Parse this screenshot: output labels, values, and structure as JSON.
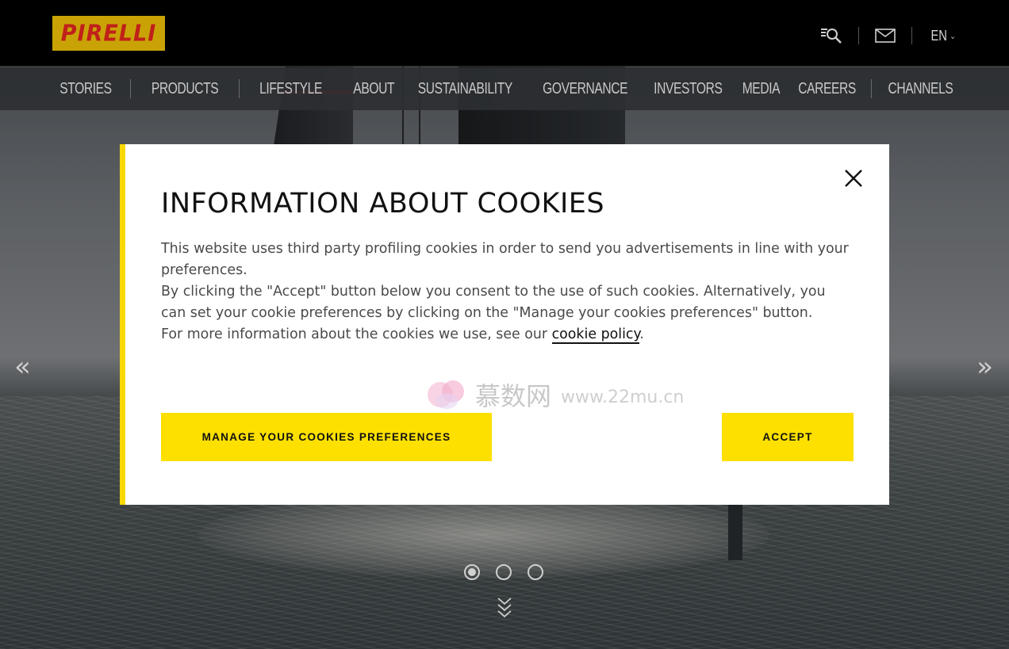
{
  "brand": {
    "logo_text": "PIRELLI",
    "logo_bg": "#c9a306",
    "logo_fg": "#c0201a",
    "accent": "#fde000"
  },
  "header": {
    "icons": [
      "search-icon",
      "mail-icon"
    ],
    "language": "EN"
  },
  "nav": {
    "left": [
      "STORIES",
      "PRODUCTS",
      "LIFESTYLE"
    ],
    "right": [
      "ABOUT",
      "SUSTAINABILITY",
      "GOVERNANCE",
      "INVESTORS",
      "MEDIA",
      "CAREERS",
      "CHANNELS"
    ]
  },
  "slider": {
    "prev_arrow": "«",
    "next_arrow": "»",
    "dots_count": 3,
    "active_dot": 1
  },
  "modal": {
    "title": "INFORMATION ABOUT COOKIES",
    "para1": "This website uses third party profiling cookies in order to send you advertisements in line with your preferences.",
    "para2": "By clicking the \"Accept\" button below you consent to the use of such cookies. Alternatively, you can set your cookie preferences by clicking on the \"Manage your cookies preferences\" button.",
    "para3_prefix": "For more information about the cookies we use, see our ",
    "para3_link": "cookie policy",
    "para3_suffix": ".",
    "manage_label": "MANAGE YOUR COOKIES PREFERENCES",
    "accept_label": "ACCEPT"
  },
  "watermark": {
    "cn": "慕数网",
    "url": "www.22mu.cn"
  }
}
